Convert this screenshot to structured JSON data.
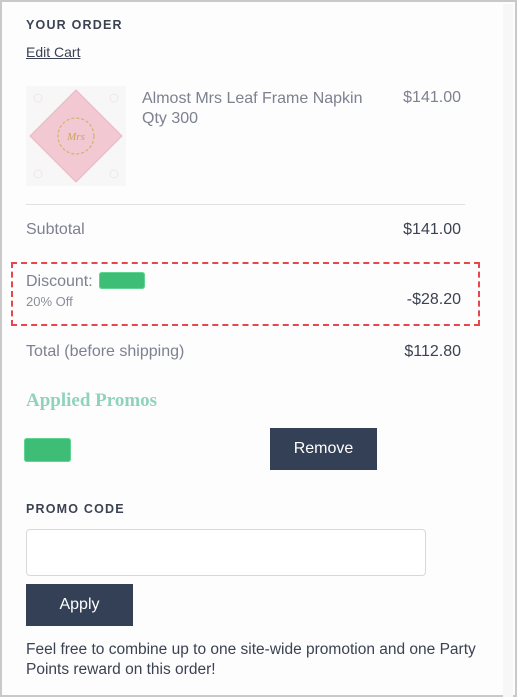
{
  "order": {
    "heading": "YOUR ORDER",
    "edit_cart": "Edit Cart"
  },
  "item": {
    "name": "Almost Mrs Leaf Frame Napkin",
    "qty": "Qty 300",
    "price": "$141.00",
    "image_text": "Mrs"
  },
  "summary": {
    "subtotal_label": "Subtotal",
    "subtotal_value": "$141.00",
    "discount_label": "Discount:",
    "discount_sub": "20% Off",
    "discount_value": "-$28.20",
    "total_label": "Total (before shipping)",
    "total_value": "$112.80"
  },
  "promos": {
    "title": "Applied Promos",
    "remove_label": "Remove"
  },
  "promo_code": {
    "heading": "PROMO CODE",
    "input_value": "",
    "placeholder": "",
    "apply_label": "Apply"
  },
  "note": "Feel free to combine up to one site-wide promotion and one Party Points reward on this order!",
  "colors": {
    "button": "#334056",
    "applied_title": "#8fd3bf",
    "redaction": "#3dbd76",
    "highlight_border": "#e4484d"
  }
}
